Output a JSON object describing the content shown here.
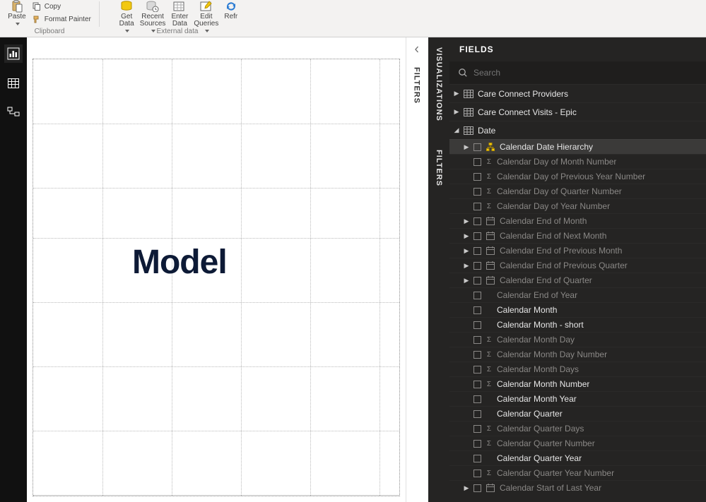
{
  "ribbon": {
    "paste": "Paste",
    "copy": "Copy",
    "format_painter": "Format Painter",
    "clipboard_group": "Clipboard",
    "get_data": "Get\nData",
    "recent_sources": "Recent\nSources",
    "enter_data": "Enter\nData",
    "edit_queries": "Edit\nQueries",
    "refresh": "Refr",
    "external_data_group": "External data"
  },
  "canvas": {
    "label": "Model"
  },
  "side": {
    "filters": "FILTERS",
    "visualizations": "VISUALIZATIONS",
    "filters2": "FILTERS"
  },
  "fields": {
    "header": "FIELDS",
    "search_placeholder": "Search",
    "tables": [
      {
        "name": "Care Connect Providers",
        "expanded": false
      },
      {
        "name": "Care Connect Visits - Epic",
        "expanded": false
      },
      {
        "name": "Date",
        "expanded": true
      }
    ],
    "date_fields": [
      {
        "label": "Calendar Date Hierarchy",
        "kind": "hierarchy",
        "highlight": true,
        "dim": false,
        "exp": true
      },
      {
        "label": "Calendar Day of Month Number",
        "kind": "sigma",
        "dim": true
      },
      {
        "label": "Calendar Day of Previous Year Number",
        "kind": "sigma",
        "dim": true
      },
      {
        "label": "Calendar Day of Quarter Number",
        "kind": "sigma",
        "dim": true
      },
      {
        "label": "Calendar Day of Year Number",
        "kind": "sigma",
        "dim": true
      },
      {
        "label": "Calendar End of Month",
        "kind": "date",
        "dim": true,
        "exp": true
      },
      {
        "label": "Calendar End of Next Month",
        "kind": "date",
        "dim": true,
        "exp": true
      },
      {
        "label": "Calendar End of Previous Month",
        "kind": "date",
        "dim": true,
        "exp": true
      },
      {
        "label": "Calendar End of Previous Quarter",
        "kind": "date",
        "dim": true,
        "exp": true
      },
      {
        "label": "Calendar End of Quarter",
        "kind": "date",
        "dim": true,
        "exp": true
      },
      {
        "label": "Calendar End of Year",
        "kind": "plain",
        "dim": true
      },
      {
        "label": "Calendar Month",
        "kind": "plain",
        "dim": false
      },
      {
        "label": "Calendar Month - short",
        "kind": "plain",
        "dim": false
      },
      {
        "label": "Calendar Month Day",
        "kind": "sigma",
        "dim": true
      },
      {
        "label": "Calendar Month Day Number",
        "kind": "sigma",
        "dim": true
      },
      {
        "label": "Calendar Month Days",
        "kind": "sigma",
        "dim": true
      },
      {
        "label": "Calendar Month Number",
        "kind": "sigma",
        "dim": false
      },
      {
        "label": "Calendar Month Year",
        "kind": "plain",
        "dim": false
      },
      {
        "label": "Calendar Quarter",
        "kind": "plain",
        "dim": false
      },
      {
        "label": "Calendar Quarter Days",
        "kind": "sigma",
        "dim": true
      },
      {
        "label": "Calendar Quarter Number",
        "kind": "sigma",
        "dim": true
      },
      {
        "label": "Calendar Quarter Year",
        "kind": "plain",
        "dim": false
      },
      {
        "label": "Calendar Quarter Year Number",
        "kind": "sigma",
        "dim": true
      },
      {
        "label": "Calendar Start of Last Year",
        "kind": "date",
        "dim": true,
        "exp": true
      }
    ]
  }
}
